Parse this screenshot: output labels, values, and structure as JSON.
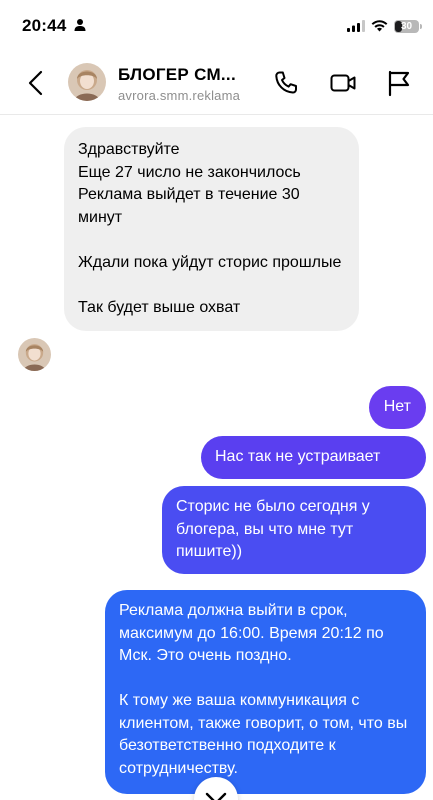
{
  "status_bar": {
    "time": "20:44",
    "battery_level": "30",
    "battery_fraction": 0.3
  },
  "header": {
    "name": "БЛОГЕР СМ...",
    "username": "avrora.smm.reklama",
    "icons": [
      "back-arrow-icon",
      "phone-icon",
      "video-camera-icon",
      "flag-icon"
    ]
  },
  "messages": [
    {
      "direction": "incoming",
      "paragraphs": [
        "Здравствуйте\nЕще 27 число не закончилось\nРеклама выйдет в течение 30 минут",
        "Ждали пока уйдут сторис прошлые",
        "Так будет выше охват"
      ]
    },
    {
      "direction": "outgoing",
      "text": "Нет"
    },
    {
      "direction": "outgoing",
      "text": "Нас так не устраивает"
    },
    {
      "direction": "outgoing",
      "text": "Сторис не было сегодня у блогера, вы что мне тут пишите))"
    },
    {
      "direction": "outgoing",
      "paragraphs": [
        "Реклама должна выйти в срок, максимум до 16:00. Время 20:12 по Мск. Это очень поздно.",
        "К тому же ваша коммуникация с клиентом, также говорит, о том, что вы безответственно подходите к сотрудничеству."
      ]
    }
  ],
  "colors": {
    "incoming_bubble": "#efefef",
    "outgoing_top": "#6a3df0",
    "outgoing_bottom": "#2d68f5"
  }
}
